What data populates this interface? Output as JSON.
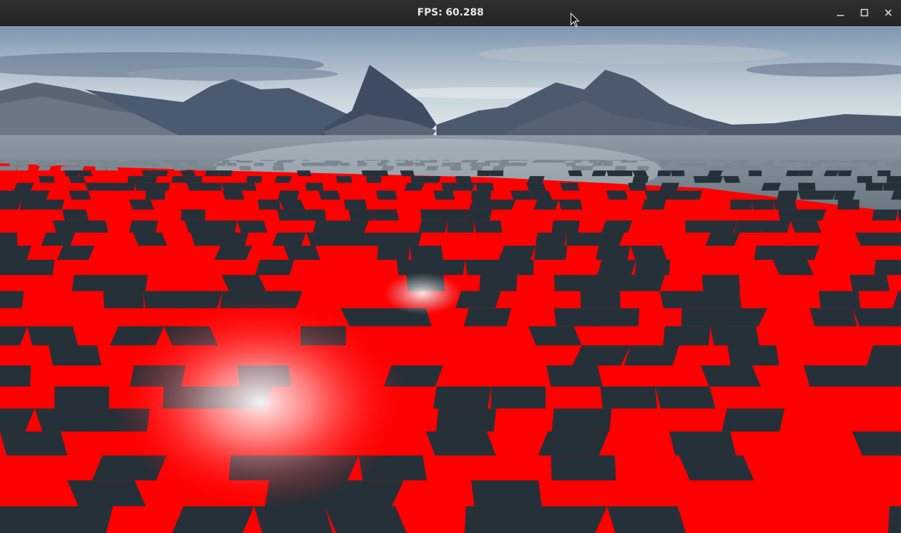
{
  "window": {
    "title": "FPS: 60.288"
  },
  "controls": {
    "minimize_icon": "minimize-icon",
    "maximize_icon": "maximize-icon",
    "close_icon": "close-icon"
  },
  "scene": {
    "overlay_color": "#ff0000",
    "water_color": "#2a3440",
    "sky_top": "#7f95b0",
    "sky_horizon": "#dfe6ea",
    "mountain_color": "#45546a"
  }
}
